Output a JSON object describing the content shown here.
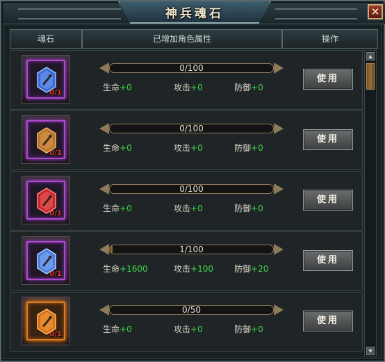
{
  "window": {
    "title": "神兵魂石",
    "close_glyph": "✕"
  },
  "header": {
    "col_stone": "魂石",
    "col_attrs": "已增加角色属性",
    "col_action": "操作"
  },
  "stat_labels": {
    "hp": "生命",
    "atk": "攻击",
    "def": "防御"
  },
  "rows": [
    {
      "color": "blue",
      "gem_fill": "#3a6ad8",
      "gem_light": "#9ec4ff",
      "frame": "purple",
      "count": "0/1",
      "progress": "0/100",
      "progress_fraction": 0,
      "hp": "+0",
      "atk": "+0",
      "def": "+0",
      "button": "使用"
    },
    {
      "color": "orange",
      "gem_fill": "#b8732a",
      "gem_light": "#f0b870",
      "frame": "purple",
      "count": "0/1",
      "progress": "0/100",
      "progress_fraction": 0,
      "hp": "+0",
      "atk": "+0",
      "def": "+0",
      "button": "使用"
    },
    {
      "color": "red",
      "gem_fill": "#c8282a",
      "gem_light": "#ff8a88",
      "frame": "purple",
      "count": "0/1",
      "progress": "0/100",
      "progress_fraction": 0,
      "hp": "+0",
      "atk": "+0",
      "def": "+0",
      "button": "使用"
    },
    {
      "color": "light-blue",
      "gem_fill": "#4a7ae0",
      "gem_light": "#b4d6ff",
      "frame": "purple",
      "count": "0/1",
      "progress": "1/100",
      "progress_fraction": 0.01,
      "hp": "+1600",
      "atk": "+100",
      "def": "+20",
      "button": "使用"
    },
    {
      "color": "amber",
      "gem_fill": "#d8701a",
      "gem_light": "#ffc060",
      "frame": "orange",
      "count": "0/1",
      "progress": "0/50",
      "progress_fraction": 0,
      "hp": "+0",
      "atk": "+0",
      "def": "+0",
      "button": "使用"
    }
  ],
  "icons": {
    "close": "close-icon",
    "gem": "soul-stone-gem-icon",
    "scroll_up": "arrow-up-icon",
    "scroll_down": "arrow-down-icon"
  },
  "colors": {
    "stat_value": "#3ed64a",
    "count_text": "#d23a2a",
    "panel_bg": "#182224"
  }
}
